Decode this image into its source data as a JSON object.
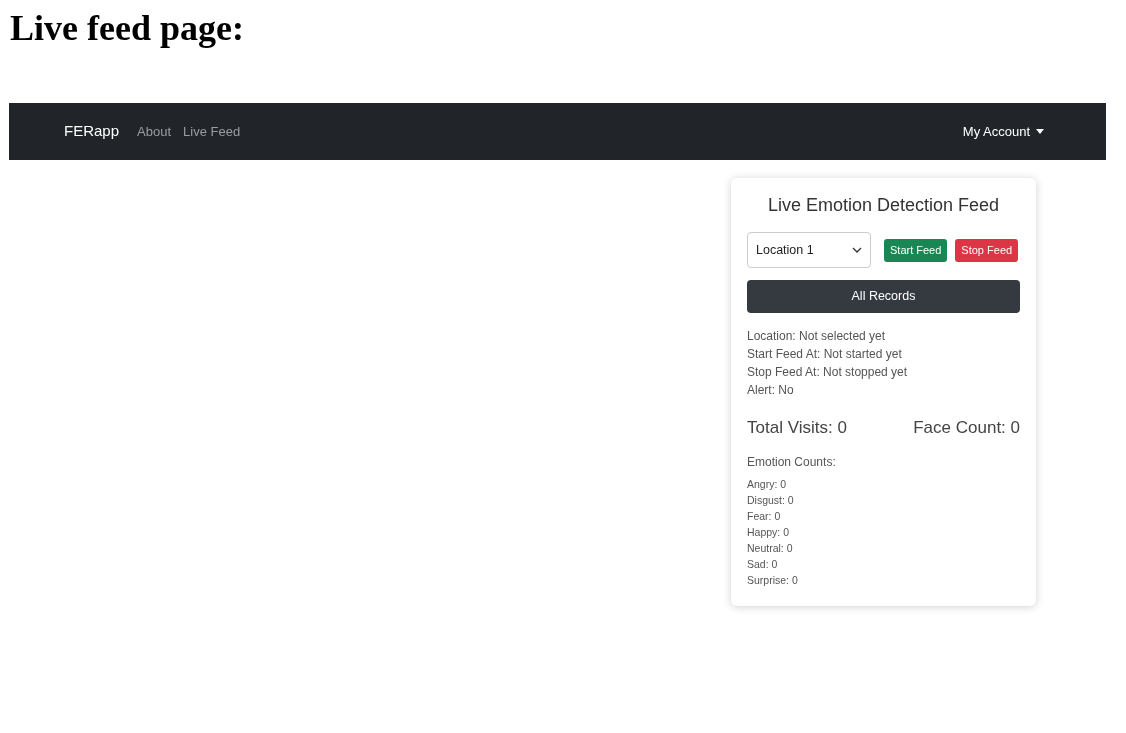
{
  "heading": "Live feed page:",
  "navbar": {
    "brand": "FERapp",
    "links": [
      "About",
      "Live Feed"
    ],
    "account": "My Account"
  },
  "card": {
    "title": "Live Emotion Detection Feed",
    "location_select": {
      "value": "Location 1"
    },
    "start_button": "Start Feed",
    "stop_button": "Stop Feed",
    "records_button": "All Records",
    "info": [
      "Location: Not selected yet",
      "Start Feed At: Not started yet",
      "Stop Feed At: Not stopped yet",
      "Alert: No"
    ],
    "total_visits": "Total Visits: 0",
    "face_count": "Face Count: 0",
    "emotion_heading": "Emotion Counts:",
    "emotions": [
      "Angry: 0",
      "Disgust: 0",
      "Fear: 0",
      "Happy: 0",
      "Neutral: 0",
      "Sad: 0",
      "Surprise: 0"
    ]
  }
}
